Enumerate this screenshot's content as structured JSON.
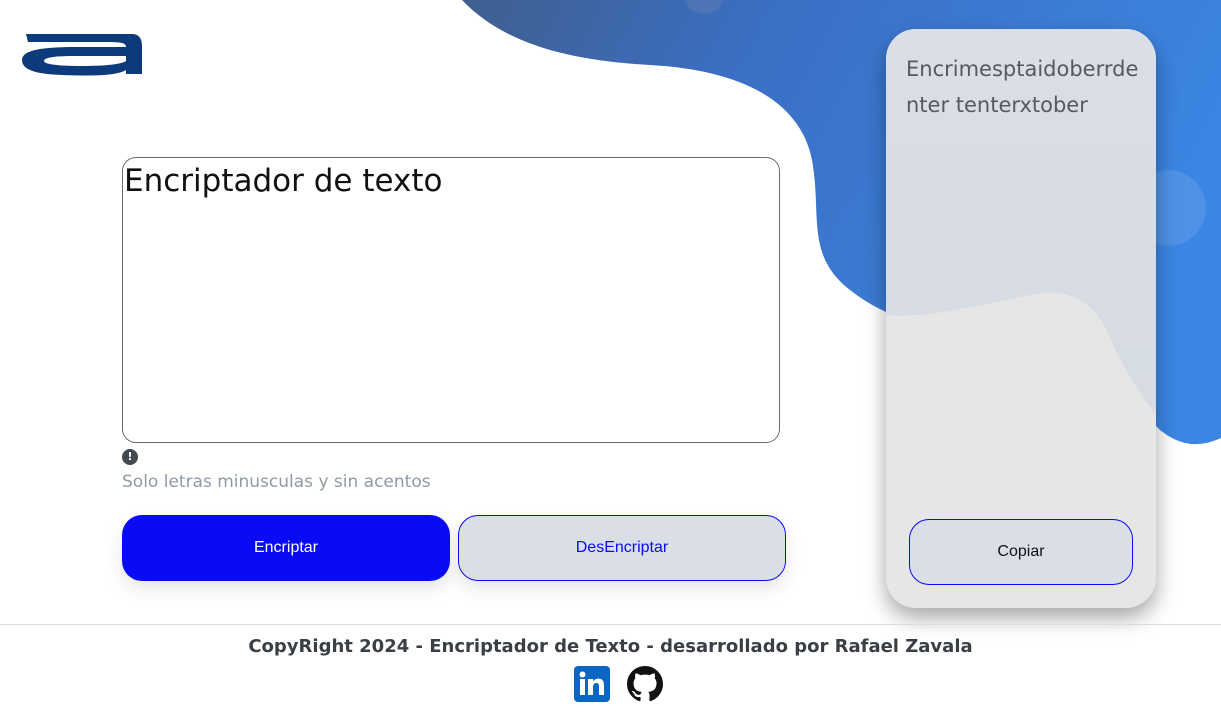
{
  "logo": {
    "letter": "a",
    "color": "#0c3a7a"
  },
  "editor": {
    "text": "Encriptador de texto"
  },
  "hint": {
    "icon": "exclamation-circle-icon",
    "text": "Solo letras minusculas y sin acentos"
  },
  "buttons": {
    "encrypt_label": "Encriptar",
    "decrypt_label": "DesEncriptar",
    "copy_label": "Copiar"
  },
  "output": {
    "text": "Encrimesptaidoberrdenter tenterxtober"
  },
  "footer": {
    "text": "CopyRight 2024 - Encriptador de Texto - desarrollado por Rafael Zavala",
    "social": [
      "linkedin-icon",
      "github-icon"
    ]
  },
  "colors": {
    "primary": "#0a0bf5",
    "blob_start": "#3d6fb6",
    "blob_end": "#3b86e3",
    "card": "#e6e6e6",
    "hint_text": "#8f9aa7"
  }
}
